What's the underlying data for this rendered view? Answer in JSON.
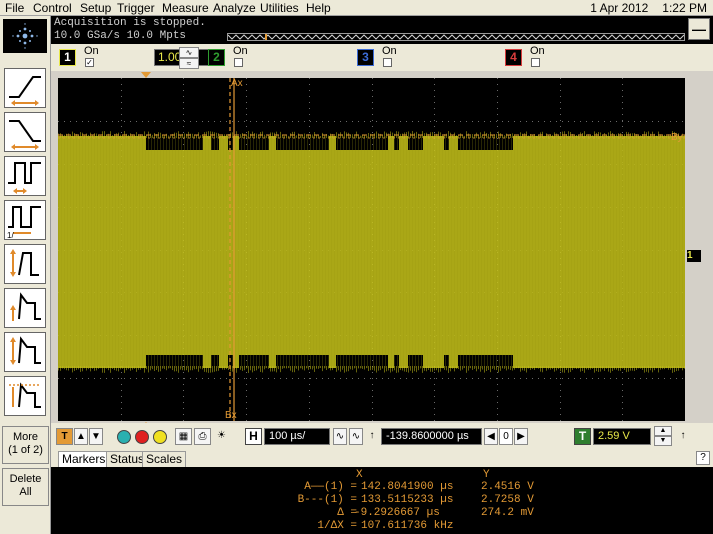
{
  "menu": [
    "File",
    "Control",
    "Setup",
    "Trigger",
    "Measure",
    "Analyze",
    "Utilities",
    "Help"
  ],
  "datetime": {
    "date": "1 Apr 2012",
    "time": "1:22 PM"
  },
  "status": {
    "line1": "Acquisition is stopped.",
    "line2": "10.0 GSa/s   10.0 Mpts"
  },
  "minimize_label": "—",
  "channels": [
    {
      "num": "1",
      "on_label": "On",
      "checked": true,
      "scale": "1.00 V/",
      "color": "#e8e84a"
    },
    {
      "num": "2",
      "on_label": "On",
      "checked": false,
      "color": "#2f9e2f"
    },
    {
      "num": "3",
      "on_label": "On",
      "checked": false,
      "color": "#3c6cd8"
    },
    {
      "num": "4",
      "on_label": "On",
      "checked": false,
      "color": "#d83c3c"
    }
  ],
  "left_toolbar": {
    "more_label": "More",
    "more_sub": "(1 of 2)",
    "delete_label": "Delete",
    "delete_sub": "All"
  },
  "scope": {
    "marker_ax_label": "Ax",
    "marker_bx_label": "Bx",
    "marker_by_label": "By",
    "trace_color": "#c8c41a",
    "marker_color": "#e39a35",
    "channel_ref_label": "1"
  },
  "controls": {
    "horizontal_label": "H",
    "timebase": "100 µs/",
    "delay": "-139.8600000 µs",
    "delay_nav": "0",
    "trigger_label": "T",
    "trigger_level": "2.59 V"
  },
  "tabs": [
    "Markers",
    "Status",
    "Scales"
  ],
  "help_label": "?",
  "markers": {
    "col_x": "X",
    "col_y": "Y",
    "rows": [
      {
        "label": "A——(1) =",
        "x": "142.8041900 µs",
        "y": "2.4516 V"
      },
      {
        "label": "B---(1) =",
        "x": "133.5115233 µs",
        "y": "2.7258 V"
      },
      {
        "label": "Δ =",
        "x": "-9.2926667 µs",
        "y": "274.2 mV"
      },
      {
        "label": "1/ΔX =",
        "x": "107.611736 kHz",
        "y": ""
      }
    ]
  }
}
